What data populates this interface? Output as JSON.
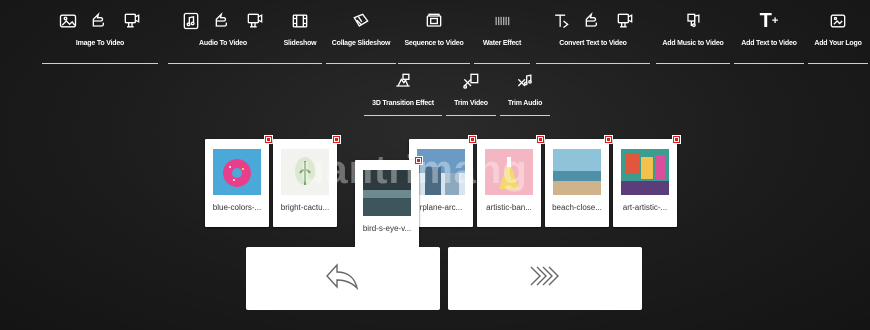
{
  "toolbar": {
    "row1": [
      {
        "label": "Image To Video",
        "icons": [
          "image-icon",
          "pointer-hand-icon",
          "video-camera-icon"
        ]
      },
      {
        "label": "Audio To Video",
        "icons": [
          "music-file-icon",
          "pointer-hand-icon",
          "video-camera-icon"
        ]
      },
      {
        "label": "Slideshow",
        "icons": [
          "film-strip-icon"
        ]
      },
      {
        "label": "Collage Slideshow",
        "icons": [
          "collage-icon"
        ]
      },
      {
        "label": "Sequence to Video",
        "icons": [
          "sequence-icon"
        ]
      },
      {
        "label": "Water Effect",
        "icons": [
          "water-effect-icon"
        ]
      },
      {
        "label": "Convert Text to Video",
        "icons": [
          "text-icon",
          "pointer-hand-icon",
          "video-camera-icon"
        ]
      },
      {
        "label": "Add Music to Video",
        "icons": [
          "add-music-icon"
        ]
      },
      {
        "label": "Add Text to Video",
        "icons": [
          "add-text-icon"
        ]
      },
      {
        "label": "Add Your Logo",
        "icons": [
          "add-logo-icon"
        ]
      }
    ],
    "row2": [
      {
        "label": "3D Transition Effect",
        "icons": [
          "3d-transition-icon"
        ]
      },
      {
        "label": "Trim Video",
        "icons": [
          "trim-video-icon"
        ]
      },
      {
        "label": "Trim Audio",
        "icons": [
          "trim-audio-icon"
        ]
      }
    ]
  },
  "thumbnails": [
    {
      "caption": "blue-colors-...",
      "colors": [
        "#4aa9d8",
        "#e83e8c"
      ]
    },
    {
      "caption": "bright-cactu...",
      "colors": [
        "#f2f2ee",
        "#7aa36a"
      ]
    },
    {
      "caption": "bird-s-eye-v...",
      "colors": [
        "#2d3a40",
        "#6d8a91"
      ]
    },
    {
      "caption": "rplane-arc...",
      "colors": [
        "#6b9ac4",
        "#d8e4ee"
      ]
    },
    {
      "caption": "artistic-ban...",
      "colors": [
        "#f4b6c2",
        "#f5d76e"
      ]
    },
    {
      "caption": "beach-close...",
      "colors": [
        "#8ec3d9",
        "#cfb38a"
      ]
    },
    {
      "caption": "art-artistic-...",
      "colors": [
        "#e2563c",
        "#3b9d8f"
      ]
    }
  ],
  "watermark": "uantrimang",
  "nav": {
    "back_icon": "back-arrow-icon",
    "next_icon": "forward-double-chevron-icon"
  }
}
